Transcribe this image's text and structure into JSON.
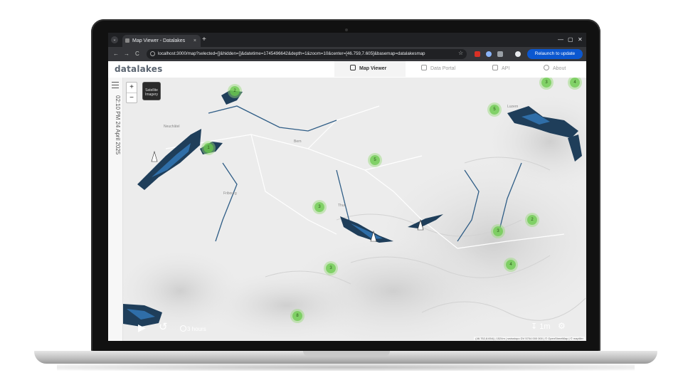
{
  "browser": {
    "tab_title": "Map Viewer - Datalakes",
    "tab_close": "×",
    "new_tab": "+",
    "tab_list": "⌄",
    "url": "localhost:3000/map?selected=[]&hidden=[]&datetime=1745496642&depth=1&zoom=10&center=[46.759,7.605]&basemap=datalakesmap",
    "relaunch_label": "Relaunch to update",
    "back": "←",
    "forward": "→",
    "reload": "C",
    "star": "☆",
    "minimize": "—",
    "maximize": "▢",
    "close": "✕"
  },
  "app": {
    "logo": "datalakes",
    "nav": [
      {
        "label": "Map Viewer",
        "active": true
      },
      {
        "label": "Data Portal",
        "active": false
      },
      {
        "label": "API",
        "active": false
      },
      {
        "label": "About",
        "active": false
      }
    ]
  },
  "sidebar": {
    "date_text": "02:10 PM 24 April 2025"
  },
  "map": {
    "zoom_in": "+",
    "zoom_out": "−",
    "basemap_label": "Satellite Imagery",
    "clusters": [
      {
        "count": "2"
      },
      {
        "count": "5"
      },
      {
        "count": "1"
      },
      {
        "count": "5"
      },
      {
        "count": "3"
      },
      {
        "count": "3"
      },
      {
        "count": "2"
      },
      {
        "count": "4"
      },
      {
        "count": "3"
      },
      {
        "count": "4"
      },
      {
        "count": "8"
      },
      {
        "count": "3"
      }
    ],
    "places": [
      "Neuchâtel",
      "Bern",
      "Fribourg",
      "Thun",
      "Luzern"
    ],
    "attribution": "(46.752,8.654) | 1524m | swisstopo DV 5704 000 000 | © OpenStreetMap | © maptiler"
  },
  "playback": {
    "play_icon": "▶",
    "step_back_icon": "↺",
    "duration_label": "3 hours",
    "depth_label": "1m",
    "depth_icon": "↧",
    "settings_icon": "⚙"
  },
  "colors": {
    "lake_dark": "#1f3e5a",
    "lake_blue": "#2f6ea8",
    "cluster_green": "#6ecd50",
    "relaunch_blue": "#0b57d0"
  }
}
